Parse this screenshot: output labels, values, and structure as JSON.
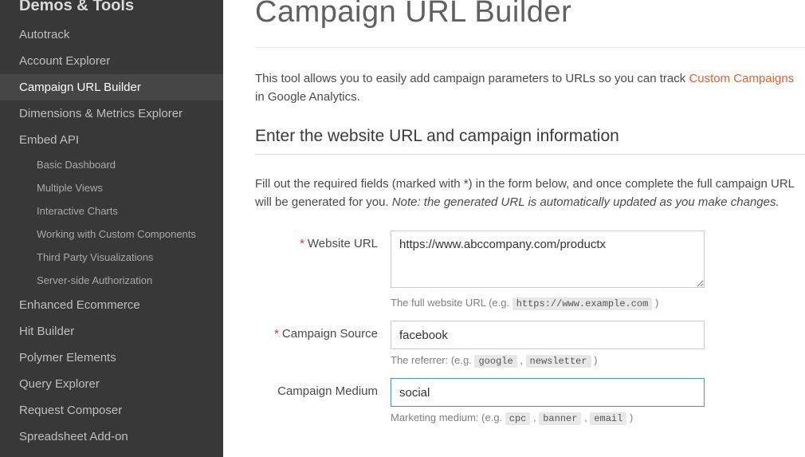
{
  "sidebar": {
    "title": "Demos & Tools",
    "items": [
      {
        "label": "Autotrack",
        "active": false
      },
      {
        "label": "Account Explorer",
        "active": false
      },
      {
        "label": "Campaign URL Builder",
        "active": true
      },
      {
        "label": "Dimensions & Metrics Explorer",
        "active": false
      },
      {
        "label": "Embed API",
        "active": false,
        "children": [
          "Basic Dashboard",
          "Multiple Views",
          "Interactive Charts",
          "Working with Custom Components",
          "Third Party Visualizations",
          "Server-side Authorization"
        ]
      },
      {
        "label": "Enhanced Ecommerce",
        "active": false
      },
      {
        "label": "Hit Builder",
        "active": false
      },
      {
        "label": "Polymer Elements",
        "active": false
      },
      {
        "label": "Query Explorer",
        "active": false
      },
      {
        "label": "Request Composer",
        "active": false
      },
      {
        "label": "Spreadsheet Add-on",
        "active": false
      }
    ]
  },
  "page": {
    "title": "Campaign URL Builder",
    "intro_prefix": "This tool allows you to easily add campaign parameters to URLs so you can track ",
    "intro_link": "Custom Campaigns",
    "intro_suffix": " in Google Analytics.",
    "section_title": "Enter the website URL and campaign information",
    "section_desc_prefix": "Fill out the required fields (marked with *) in the form below, and once complete the full campaign URL will be generated for you. ",
    "section_desc_note": "Note: the generated URL is automatically updated as you make changes."
  },
  "form": {
    "website_url": {
      "label": "Website URL",
      "required": true,
      "value": "https://www.abccompany.com/productx",
      "help_prefix": "The full website URL (e.g. ",
      "help_code": "https://www.example.com",
      "help_suffix": " )"
    },
    "campaign_source": {
      "label": "Campaign Source",
      "required": true,
      "value": "facebook",
      "help_prefix": "The referrer: (e.g. ",
      "help_code1": "google",
      "help_sep": " , ",
      "help_code2": "newsletter",
      "help_suffix": " )"
    },
    "campaign_medium": {
      "label": "Campaign Medium",
      "required": false,
      "value": "social",
      "help_prefix": "Marketing medium: (e.g. ",
      "help_code1": "cpc",
      "help_sep1": " , ",
      "help_code2": "banner",
      "help_sep2": " , ",
      "help_code3": "email",
      "help_suffix": " )"
    }
  }
}
